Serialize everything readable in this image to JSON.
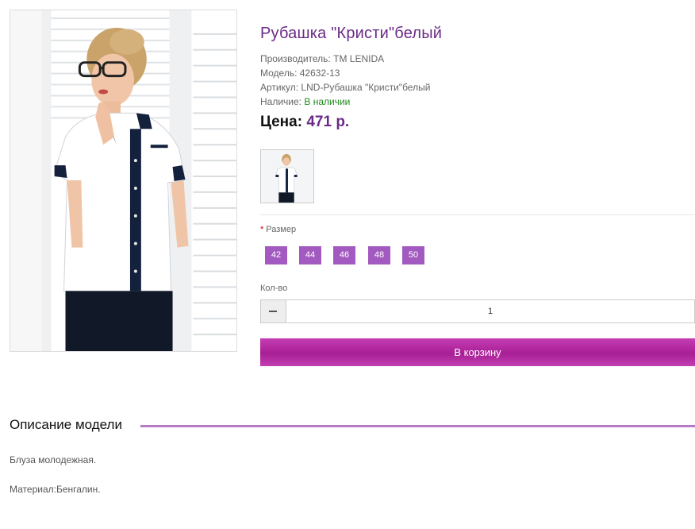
{
  "product": {
    "title": "Рубашка \"Кристи\"белый",
    "manufacturer_label": "Производитель:",
    "manufacturer": "TM LENIDA",
    "model_label": "Модель:",
    "model": "42632-13",
    "sku_label": "Артикул:",
    "sku": "LND-Рубашка \"Кристи\"белый",
    "availability_label": "Наличие:",
    "availability": "В наличии",
    "price_label": "Цена:",
    "price": "471 р."
  },
  "options": {
    "required_mark": "*",
    "size_label": "Размер",
    "sizes": [
      "42",
      "44",
      "46",
      "48",
      "50"
    ]
  },
  "quantity": {
    "label": "Кол-во",
    "value": "1"
  },
  "cart": {
    "button_label": "В корзину"
  },
  "description": {
    "heading": "Описание модели",
    "paragraphs": [
      "Блуза молодежная.",
      "Материал:Бенгалин."
    ]
  },
  "colors": {
    "accent": "#6a2a86",
    "size_button": "#a35ac0",
    "cart_button": "#b0279e",
    "in_stock": "#1e8a1e",
    "divider": "#b779c8"
  },
  "icons": {
    "qty_decrease": "minus-icon"
  }
}
